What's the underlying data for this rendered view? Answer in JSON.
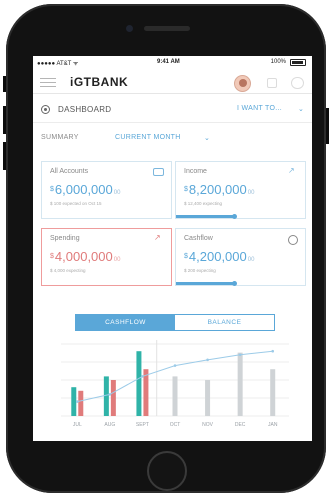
{
  "status_bar": {
    "carrier": "●●●●● AT&T ᯤ",
    "time": "9:41 AM",
    "battery": "100%"
  },
  "app_bar": {
    "logo": "iGTBANK"
  },
  "dashboard": {
    "title": "DASHBOARD",
    "i_want_to": "I WANT TO...",
    "i_want_to_chevron": "⌄"
  },
  "summary": {
    "label": "SUMMARY",
    "period": "CURRENT MONTH",
    "period_chevron": "⌄"
  },
  "cards": [
    {
      "title": "All Accounts",
      "symbol": "$",
      "amount": "6,000,000",
      "cents": "00",
      "sub": "$ 100 expected on Oct 15",
      "icon": "wallet-icon",
      "progress": 0
    },
    {
      "title": "Income",
      "symbol": "$",
      "amount": "8,200,000",
      "cents": "00",
      "sub": "$ 12,400 expecting",
      "icon": "trend-up-icon",
      "progress": 0.45
    },
    {
      "title": "Spending",
      "symbol": "$",
      "amount": "4,000,000",
      "cents": "00",
      "sub": "$ 4,000 expecting",
      "icon": "trend-up-icon",
      "progress": 0
    },
    {
      "title": "Cashflow",
      "symbol": "$",
      "amount": "4,200,000",
      "cents": "00",
      "sub": "$ 200 expecting",
      "icon": "refresh-icon",
      "progress": 0.45
    }
  ],
  "chart_toggle": {
    "options": [
      "CASHFLOW",
      "BALANCE"
    ],
    "active": "CASHFLOW"
  },
  "colors": {
    "accent": "#5aa7d8",
    "teal": "#2fb3a8",
    "red": "#e07b7b",
    "muted_bar": "#cfd3d6"
  },
  "chart_data": {
    "type": "bar",
    "categories": [
      "JUL",
      "AUG",
      "SEPT",
      "OCT",
      "NOV",
      "DEC",
      "JAN"
    ],
    "series": [
      {
        "values": [
          40,
          55,
          90,
          0,
          0,
          0,
          0
        ]
      },
      {
        "values": [
          35,
          50,
          65,
          0,
          0,
          0,
          0
        ]
      },
      {
        "values": [
          0,
          0,
          0,
          55,
          50,
          88,
          65
        ]
      }
    ],
    "line": [
      20,
      30,
      55,
      70,
      78,
      85,
      90
    ],
    "ylim": [
      0,
      100
    ],
    "grid": true
  }
}
